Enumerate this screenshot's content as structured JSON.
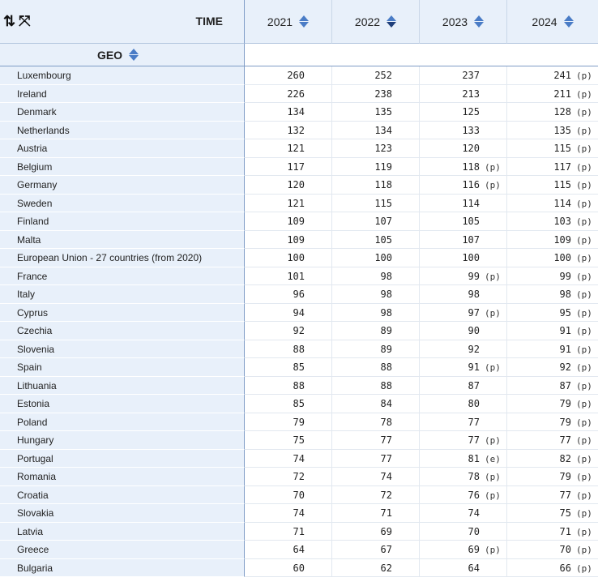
{
  "header": {
    "time_label": "TIME",
    "geo_label": "GEO",
    "years": [
      "2021",
      "2022",
      "2023",
      "2024"
    ],
    "sort_icon_names": [
      "sort-icon"
    ],
    "toolbar_icons": [
      "sort-toggle-icon",
      "expand-icon"
    ]
  },
  "colors": {
    "header_bg": "#e8f0fa",
    "accent_blue": "#4a7cc6",
    "border_blue": "#7f9cc6"
  },
  "table": {
    "rows": [
      {
        "geo": "Luxembourg",
        "values": [
          [
            "260",
            ""
          ],
          [
            "252",
            ""
          ],
          [
            "237",
            ""
          ],
          [
            "241",
            "(p)"
          ]
        ]
      },
      {
        "geo": "Ireland",
        "values": [
          [
            "226",
            ""
          ],
          [
            "238",
            ""
          ],
          [
            "213",
            ""
          ],
          [
            "211",
            "(p)"
          ]
        ]
      },
      {
        "geo": "Denmark",
        "values": [
          [
            "134",
            ""
          ],
          [
            "135",
            ""
          ],
          [
            "125",
            ""
          ],
          [
            "128",
            "(p)"
          ]
        ]
      },
      {
        "geo": "Netherlands",
        "values": [
          [
            "132",
            ""
          ],
          [
            "134",
            ""
          ],
          [
            "133",
            ""
          ],
          [
            "135",
            "(p)"
          ]
        ]
      },
      {
        "geo": "Austria",
        "values": [
          [
            "121",
            ""
          ],
          [
            "123",
            ""
          ],
          [
            "120",
            ""
          ],
          [
            "115",
            "(p)"
          ]
        ]
      },
      {
        "geo": "Belgium",
        "values": [
          [
            "117",
            ""
          ],
          [
            "119",
            ""
          ],
          [
            "118",
            "(p)"
          ],
          [
            "117",
            "(p)"
          ]
        ]
      },
      {
        "geo": "Germany",
        "values": [
          [
            "120",
            ""
          ],
          [
            "118",
            ""
          ],
          [
            "116",
            "(p)"
          ],
          [
            "115",
            "(p)"
          ]
        ]
      },
      {
        "geo": "Sweden",
        "values": [
          [
            "121",
            ""
          ],
          [
            "115",
            ""
          ],
          [
            "114",
            ""
          ],
          [
            "114",
            "(p)"
          ]
        ]
      },
      {
        "geo": "Finland",
        "values": [
          [
            "109",
            ""
          ],
          [
            "107",
            ""
          ],
          [
            "105",
            ""
          ],
          [
            "103",
            "(p)"
          ]
        ]
      },
      {
        "geo": "Malta",
        "values": [
          [
            "109",
            ""
          ],
          [
            "105",
            ""
          ],
          [
            "107",
            ""
          ],
          [
            "109",
            "(p)"
          ]
        ]
      },
      {
        "geo": "European Union - 27 countries (from 2020)",
        "values": [
          [
            "100",
            ""
          ],
          [
            "100",
            ""
          ],
          [
            "100",
            ""
          ],
          [
            "100",
            "(p)"
          ]
        ]
      },
      {
        "geo": "France",
        "values": [
          [
            "101",
            ""
          ],
          [
            "98",
            ""
          ],
          [
            "99",
            "(p)"
          ],
          [
            "99",
            "(p)"
          ]
        ]
      },
      {
        "geo": "Italy",
        "values": [
          [
            "96",
            ""
          ],
          [
            "98",
            ""
          ],
          [
            "98",
            ""
          ],
          [
            "98",
            "(p)"
          ]
        ]
      },
      {
        "geo": "Cyprus",
        "values": [
          [
            "94",
            ""
          ],
          [
            "98",
            ""
          ],
          [
            "97",
            "(p)"
          ],
          [
            "95",
            "(p)"
          ]
        ]
      },
      {
        "geo": "Czechia",
        "values": [
          [
            "92",
            ""
          ],
          [
            "89",
            ""
          ],
          [
            "90",
            ""
          ],
          [
            "91",
            "(p)"
          ]
        ]
      },
      {
        "geo": "Slovenia",
        "values": [
          [
            "88",
            ""
          ],
          [
            "89",
            ""
          ],
          [
            "92",
            ""
          ],
          [
            "91",
            "(p)"
          ]
        ]
      },
      {
        "geo": "Spain",
        "values": [
          [
            "85",
            ""
          ],
          [
            "88",
            ""
          ],
          [
            "91",
            "(p)"
          ],
          [
            "92",
            "(p)"
          ]
        ]
      },
      {
        "geo": "Lithuania",
        "values": [
          [
            "88",
            ""
          ],
          [
            "88",
            ""
          ],
          [
            "87",
            ""
          ],
          [
            "87",
            "(p)"
          ]
        ]
      },
      {
        "geo": "Estonia",
        "values": [
          [
            "85",
            ""
          ],
          [
            "84",
            ""
          ],
          [
            "80",
            ""
          ],
          [
            "79",
            "(p)"
          ]
        ]
      },
      {
        "geo": "Poland",
        "values": [
          [
            "79",
            ""
          ],
          [
            "78",
            ""
          ],
          [
            "77",
            ""
          ],
          [
            "79",
            "(p)"
          ]
        ]
      },
      {
        "geo": "Hungary",
        "values": [
          [
            "75",
            ""
          ],
          [
            "77",
            ""
          ],
          [
            "77",
            "(p)"
          ],
          [
            "77",
            "(p)"
          ]
        ]
      },
      {
        "geo": "Portugal",
        "values": [
          [
            "74",
            ""
          ],
          [
            "77",
            ""
          ],
          [
            "81",
            "(e)"
          ],
          [
            "82",
            "(p)"
          ]
        ]
      },
      {
        "geo": "Romania",
        "values": [
          [
            "72",
            ""
          ],
          [
            "74",
            ""
          ],
          [
            "78",
            "(p)"
          ],
          [
            "79",
            "(p)"
          ]
        ]
      },
      {
        "geo": "Croatia",
        "values": [
          [
            "70",
            ""
          ],
          [
            "72",
            ""
          ],
          [
            "76",
            "(p)"
          ],
          [
            "77",
            "(p)"
          ]
        ]
      },
      {
        "geo": "Slovakia",
        "values": [
          [
            "74",
            ""
          ],
          [
            "71",
            ""
          ],
          [
            "74",
            ""
          ],
          [
            "75",
            "(p)"
          ]
        ]
      },
      {
        "geo": "Latvia",
        "values": [
          [
            "71",
            ""
          ],
          [
            "69",
            ""
          ],
          [
            "70",
            ""
          ],
          [
            "71",
            "(p)"
          ]
        ]
      },
      {
        "geo": "Greece",
        "values": [
          [
            "64",
            ""
          ],
          [
            "67",
            ""
          ],
          [
            "69",
            "(p)"
          ],
          [
            "70",
            "(p)"
          ]
        ]
      },
      {
        "geo": "Bulgaria",
        "values": [
          [
            "60",
            ""
          ],
          [
            "62",
            ""
          ],
          [
            "64",
            ""
          ],
          [
            "66",
            "(p)"
          ]
        ]
      }
    ]
  }
}
